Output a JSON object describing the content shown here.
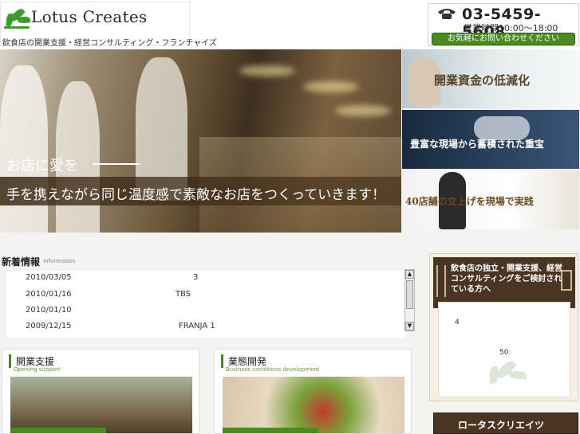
{
  "header": {
    "brand": "Lotus Creates",
    "tagline": "飲食店の開業支援・経営コンサルティング・フランチャイズ",
    "phone": "03-5459-5608",
    "hours": "営業時間10:00～18:00",
    "inquiry_label": "お気軽にお問い合わせください",
    "logo_icon": "lotus-leaf-icon",
    "phone_icon": "telephone-icon"
  },
  "hero": {
    "catch": "お店に愛を",
    "text": "手を携えながら同じ温度感で素敵なお店をつくっていきます！"
  },
  "side_panels": [
    {
      "label": "開業資金の低減化"
    },
    {
      "label": "豊富な現場から蓄積された重宝"
    },
    {
      "label": "40店舗の立上げを現場で実践"
    }
  ],
  "news": {
    "title": "新着情報",
    "subtitle": "Information",
    "items": [
      {
        "date": "2010/03/05",
        "text": "3"
      },
      {
        "date": "2010/01/16",
        "text": "TBS"
      },
      {
        "date": "2010/01/10",
        "text": ""
      },
      {
        "date": "2009/12/15",
        "text": "FRANJA 1"
      }
    ],
    "scroll_up": "▲",
    "scroll_down": "▼"
  },
  "cards": [
    {
      "title": "開業支援",
      "subtitle": "Opening support"
    },
    {
      "title": "業態開発",
      "subtitle": "Business conditions development"
    }
  ],
  "right_box": {
    "heading": "飲食店の独立・開業支援、経営コンサルティングをご検討されている方へ",
    "num1": "4",
    "num2": "50"
  },
  "company_button": "ロータスクリエイツ",
  "colors": {
    "accent_green": "#4b8a1f",
    "panel_brown": "#4a3522"
  }
}
